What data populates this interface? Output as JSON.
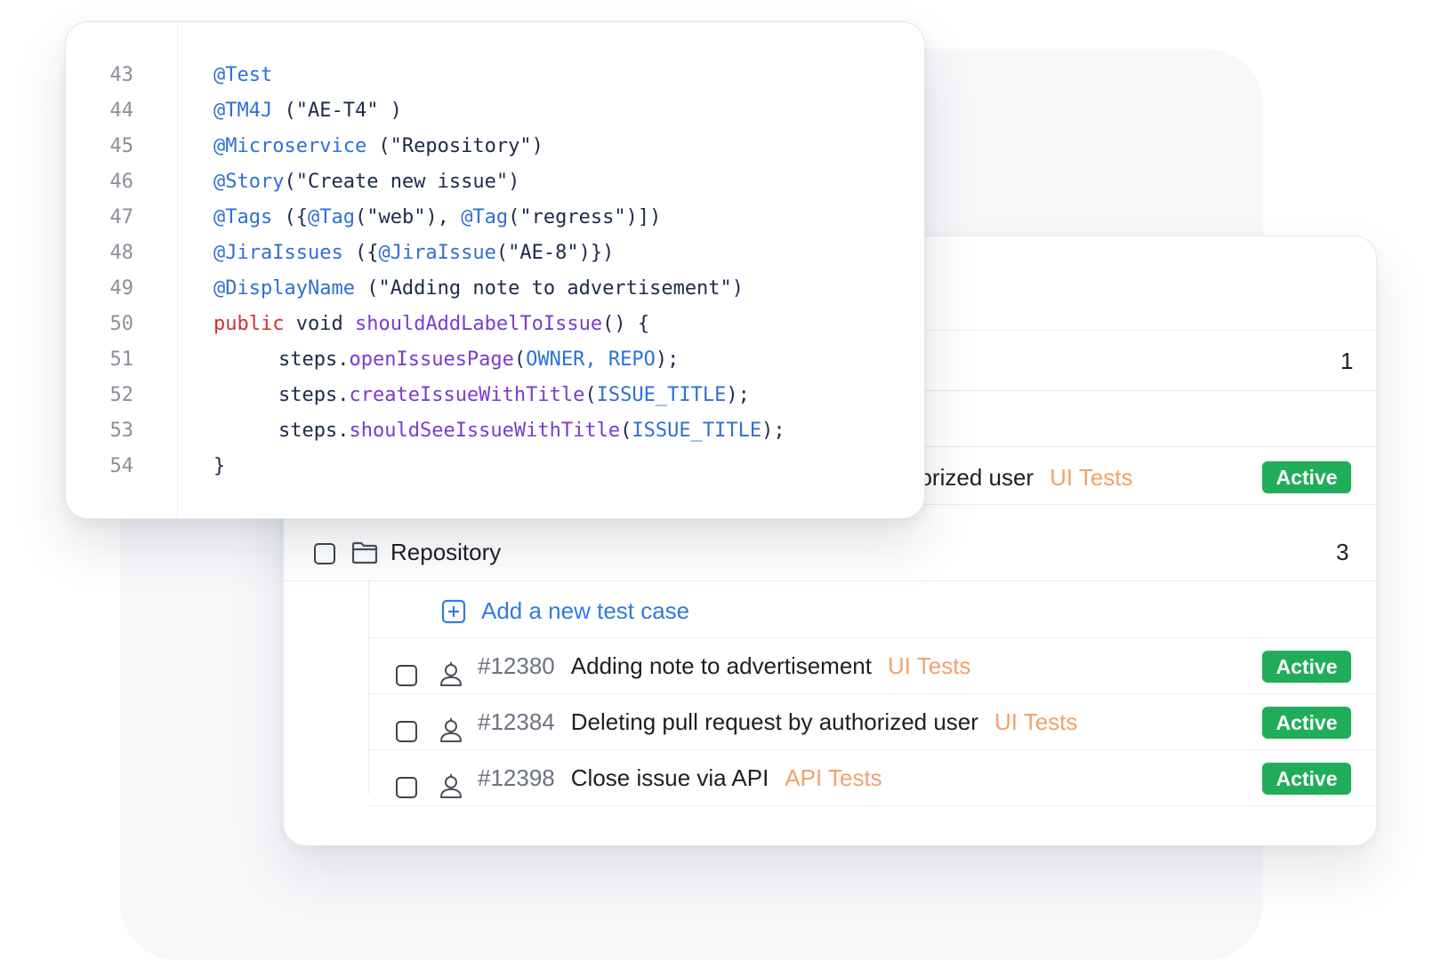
{
  "code_editor": {
    "line_numbers": [
      "43",
      "44",
      "45",
      "46",
      "47",
      "48",
      "49",
      "50",
      "51",
      "52",
      "53",
      "54"
    ],
    "lines": [
      {
        "indent": false,
        "tokens": [
          {
            "t": "ann",
            "v": "@Test"
          }
        ]
      },
      {
        "indent": false,
        "tokens": [
          {
            "t": "ann",
            "v": "@TM4J"
          },
          {
            "t": "plain",
            "v": " (\"AE-T4\" )"
          }
        ]
      },
      {
        "indent": false,
        "tokens": [
          {
            "t": "ann",
            "v": "@Microservice"
          },
          {
            "t": "plain",
            "v": " (\"Repository\")"
          }
        ]
      },
      {
        "indent": false,
        "tokens": [
          {
            "t": "ann",
            "v": "@Story"
          },
          {
            "t": "plain",
            "v": "(\"Create new issue\")"
          }
        ]
      },
      {
        "indent": false,
        "tokens": [
          {
            "t": "ann",
            "v": "@Tags"
          },
          {
            "t": "plain",
            "v": " ({"
          },
          {
            "t": "ann",
            "v": "@Tag"
          },
          {
            "t": "plain",
            "v": "(\"web\"), "
          },
          {
            "t": "ann",
            "v": "@Tag"
          },
          {
            "t": "plain",
            "v": "(\"regress\")])"
          }
        ]
      },
      {
        "indent": false,
        "tokens": [
          {
            "t": "ann",
            "v": "@JiraIssues"
          },
          {
            "t": "plain",
            "v": " ({"
          },
          {
            "t": "ann",
            "v": "@JiraIssue"
          },
          {
            "t": "plain",
            "v": "(\"AE-8\")})"
          }
        ]
      },
      {
        "indent": false,
        "tokens": [
          {
            "t": "ann",
            "v": "@DisplayName"
          },
          {
            "t": "plain",
            "v": " (\"Adding note to advertisement\")"
          }
        ]
      },
      {
        "indent": false,
        "tokens": [
          {
            "t": "kw",
            "v": "public"
          },
          {
            "t": "plain",
            "v": " void "
          },
          {
            "t": "fn",
            "v": "shouldAddLabelToIssue"
          },
          {
            "t": "plain",
            "v": "() {"
          }
        ]
      },
      {
        "indent": true,
        "tokens": [
          {
            "t": "plain",
            "v": "steps."
          },
          {
            "t": "fn",
            "v": "openIssuesPage"
          },
          {
            "t": "plain",
            "v": "("
          },
          {
            "t": "const",
            "v": "OWNER, REPO"
          },
          {
            "t": "plain",
            "v": ");"
          }
        ]
      },
      {
        "indent": true,
        "tokens": [
          {
            "t": "plain",
            "v": "steps."
          },
          {
            "t": "fn",
            "v": "createIssueWithTitle"
          },
          {
            "t": "plain",
            "v": "("
          },
          {
            "t": "const",
            "v": "ISSUE_TITLE"
          },
          {
            "t": "plain",
            "v": ");"
          }
        ]
      },
      {
        "indent": true,
        "tokens": [
          {
            "t": "plain",
            "v": "steps."
          },
          {
            "t": "fn",
            "v": "shouldSeeIssueWithTitle"
          },
          {
            "t": "plain",
            "v": "("
          },
          {
            "t": "const",
            "v": "ISSUE_TITLE"
          },
          {
            "t": "plain",
            "v": ");"
          }
        ]
      },
      {
        "indent": false,
        "tokens": [
          {
            "t": "plain",
            "v": "}"
          }
        ]
      }
    ]
  },
  "test_cases": {
    "first_suite_count": "1",
    "partial_case": {
      "title_fragment": "norized user",
      "tag": "UI Tests",
      "status": "Active"
    },
    "suite": {
      "name": "Repository",
      "count": "3"
    },
    "add_label": "Add a new test case",
    "cases": [
      {
        "id": "#12380",
        "title": "Adding note to advertisement",
        "tag": "UI Tests",
        "status": "Active"
      },
      {
        "id": "#12384",
        "title": "Deleting pull request by authorized user",
        "tag": "UI Tests",
        "status": "Active"
      },
      {
        "id": "#12398",
        "title": "Close issue via API",
        "tag": "API Tests",
        "status": "Active"
      }
    ]
  },
  "colors": {
    "annotation": "#2f6fd6",
    "keyword": "#d0312d",
    "function": "#7b3bd1",
    "tag": "#f0a26b",
    "status_active": "#20ad5a",
    "link": "#2f7be0"
  }
}
